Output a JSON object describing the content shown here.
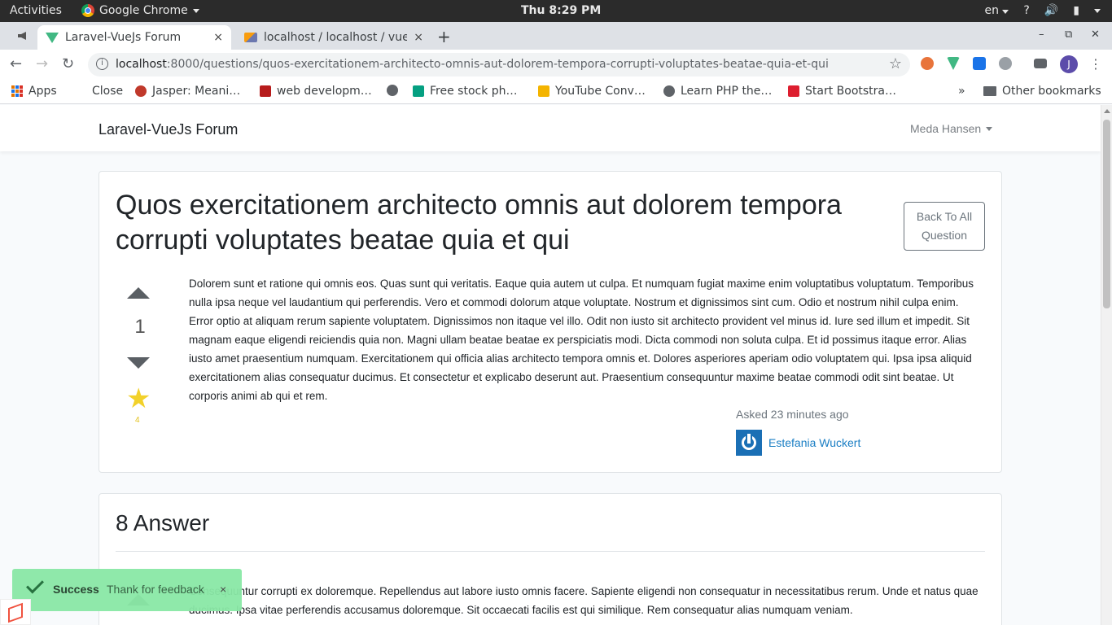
{
  "topbar": {
    "activities": "Activities",
    "app_name": "Google Chrome",
    "clock": "Thu  8:29 PM",
    "language": "en",
    "help": "?"
  },
  "tabs": [
    {
      "title": "Laravel-VueJs Forum",
      "close": "×"
    },
    {
      "title": "localhost / localhost / vue",
      "close": "×"
    }
  ],
  "new_tab": "+",
  "window_controls": {
    "minimize": "–",
    "maximize": "⧉",
    "close": "✕"
  },
  "omnibox": {
    "host": "localhost",
    "path": ":8000/questions/quos-exercitationem-architecto-omnis-aut-dolorem-tempora-corrupti-voluptates-beatae-quia-et-qui",
    "profile_initial": "J"
  },
  "bookmarks": {
    "items": [
      "Apps",
      "Close",
      "Jasper: Meani…",
      "web developm…",
      "Free stock ph…",
      "YouTube Conv…",
      "Learn PHP the…",
      "Start Bootstra…"
    ],
    "overflow": "»",
    "other": "Other bookmarks"
  },
  "site": {
    "brand": "Laravel-VueJs Forum",
    "user": "Meda Hansen"
  },
  "question": {
    "title": "Quos exercitationem architecto omnis aut dolorem tempora corrupti voluptates beatae quia et qui",
    "back_button": "Back To All Question",
    "votes": "1",
    "favorites": "4",
    "body": "Dolorem sunt et ratione qui omnis eos. Quas sunt qui veritatis. Eaque quia autem ut culpa. Et numquam fugiat maxime enim voluptatibus voluptatum. Temporibus nulla ipsa neque vel laudantium qui perferendis. Vero et commodi dolorum atque voluptate. Nostrum et dignissimos sint cum. Odio et nostrum nihil culpa enim. Error optio at aliquam rerum sapiente voluptatem. Dignissimos non itaque vel illo. Odit non iusto sit architecto provident vel minus id. Iure sed illum et impedit. Sit magnam eaque eligendi reiciendis quia non. Magni ullam beatae beatae ex perspiciatis modi. Dicta commodi non soluta culpa. Et id possimus itaque error. Alias iusto amet praesentium numquam. Exercitationem qui officia alias architecto tempora omnis et. Dolores asperiores aperiam odio voluptatem qui. Ipsa ipsa aliquid exercitationem alias consequatur ducimus. Et consectetur et explicabo deserunt aut. Praesentium consequuntur maxime beatae commodi odit sint beatae. Ut corporis animi ab qui et rem.",
    "asked": "Asked 23 minutes ago",
    "author": "Estefania Wuckert"
  },
  "answers": {
    "title": "8 Answer",
    "first_body": "Consequuntur corrupti ex doloremque. Repellendus aut labore iusto omnis facere. Sapiente eligendi non consequatur in necessitatibus rerum. Unde et natus quae ducimus. Ipsa vitae perferendis accusamus doloremque. Sit occaecati facilis est qui similique. Rem consequatur alias numquam veniam."
  },
  "toast": {
    "title": "Success",
    "message": "Thank for feedback",
    "close": "×"
  }
}
